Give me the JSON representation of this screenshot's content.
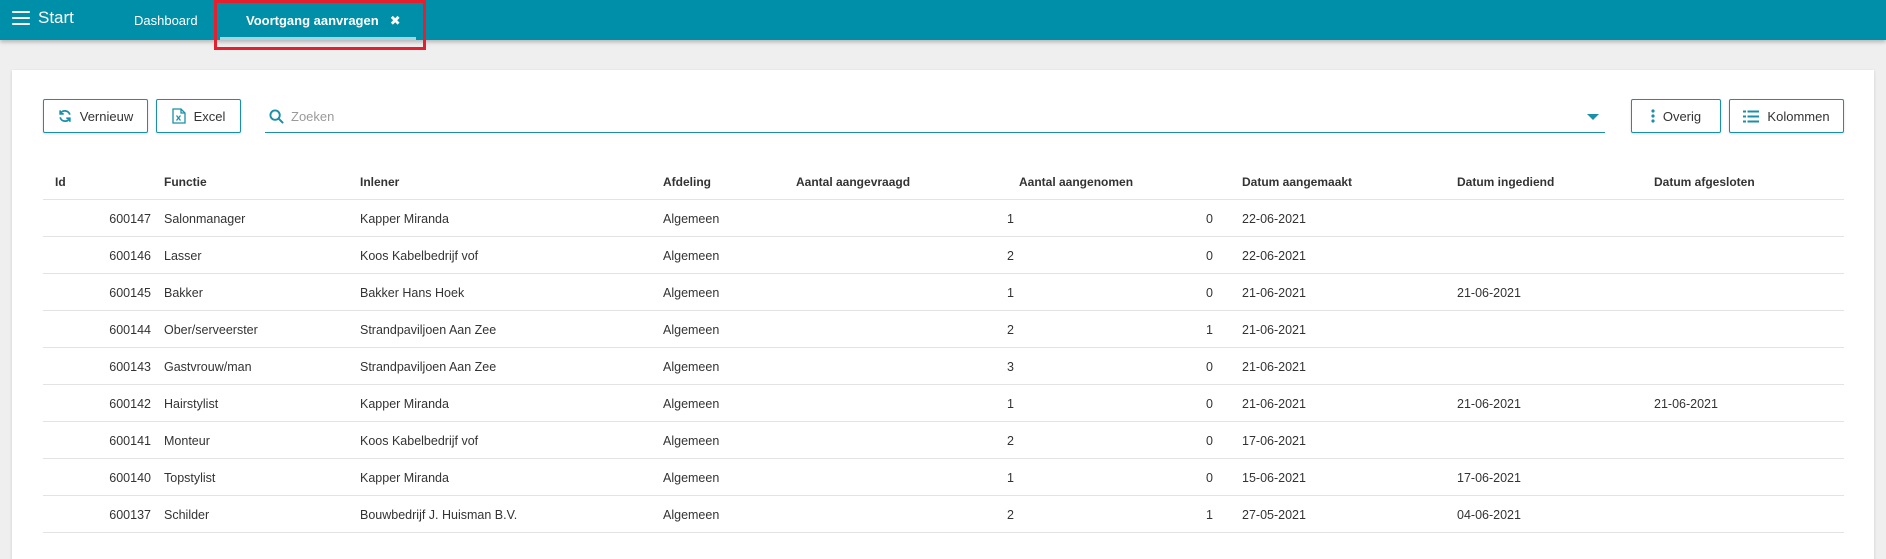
{
  "header": {
    "start_label": "Start",
    "tabs": [
      {
        "label": "Dashboard"
      },
      {
        "label": "Voortgang aanvragen"
      }
    ]
  },
  "toolbar": {
    "refresh_label": "Vernieuw",
    "excel_label": "Excel",
    "search_placeholder": "Zoeken",
    "overig_label": "Overig",
    "kolommen_label": "Kolommen"
  },
  "table": {
    "columns": [
      "Id",
      "Functie",
      "Inlener",
      "Afdeling",
      "Aantal aangevraagd",
      "Aantal aangenomen",
      "Datum aangemaakt",
      "Datum ingediend",
      "Datum afgesloten"
    ],
    "rows": [
      {
        "id": "600147",
        "functie": "Salonmanager",
        "inlener": "Kapper Miranda",
        "afdeling": "Algemeen",
        "aangevraagd": "1",
        "aangenomen": "0",
        "aangemaakt": "22-06-2021",
        "ingediend": "",
        "afgesloten": ""
      },
      {
        "id": "600146",
        "functie": "Lasser",
        "inlener": "Koos Kabelbedrijf vof",
        "afdeling": "Algemeen",
        "aangevraagd": "2",
        "aangenomen": "0",
        "aangemaakt": "22-06-2021",
        "ingediend": "",
        "afgesloten": ""
      },
      {
        "id": "600145",
        "functie": "Bakker",
        "inlener": "Bakker Hans Hoek",
        "afdeling": "Algemeen",
        "aangevraagd": "1",
        "aangenomen": "0",
        "aangemaakt": "21-06-2021",
        "ingediend": "21-06-2021",
        "afgesloten": ""
      },
      {
        "id": "600144",
        "functie": "Ober/serveerster",
        "inlener": "Strandpaviljoen Aan Zee",
        "afdeling": "Algemeen",
        "aangevraagd": "2",
        "aangenomen": "1",
        "aangemaakt": "21-06-2021",
        "ingediend": "",
        "afgesloten": ""
      },
      {
        "id": "600143",
        "functie": "Gastvrouw/man",
        "inlener": "Strandpaviljoen Aan Zee",
        "afdeling": "Algemeen",
        "aangevraagd": "3",
        "aangenomen": "0",
        "aangemaakt": "21-06-2021",
        "ingediend": "",
        "afgesloten": ""
      },
      {
        "id": "600142",
        "functie": "Hairstylist",
        "inlener": "Kapper Miranda",
        "afdeling": "Algemeen",
        "aangevraagd": "1",
        "aangenomen": "0",
        "aangemaakt": "21-06-2021",
        "ingediend": "21-06-2021",
        "afgesloten": "21-06-2021"
      },
      {
        "id": "600141",
        "functie": "Monteur",
        "inlener": "Koos Kabelbedrijf vof",
        "afdeling": "Algemeen",
        "aangevraagd": "2",
        "aangenomen": "0",
        "aangemaakt": "17-06-2021",
        "ingediend": "",
        "afgesloten": ""
      },
      {
        "id": "600140",
        "functie": "Topstylist",
        "inlener": "Kapper Miranda",
        "afdeling": "Algemeen",
        "aangevraagd": "1",
        "aangenomen": "0",
        "aangemaakt": "15-06-2021",
        "ingediend": "17-06-2021",
        "afgesloten": ""
      },
      {
        "id": "600137",
        "functie": "Schilder",
        "inlener": "Bouwbedrijf J. Huisman B.V.",
        "afdeling": "Algemeen",
        "aangevraagd": "2",
        "aangenomen": "1",
        "aangemaakt": "27-05-2021",
        "ingediend": "04-06-2021",
        "afgesloten": ""
      }
    ]
  },
  "colors": {
    "topbar": "#008fa8",
    "accent": "#1a8fa8",
    "highlight": "#e5202e"
  }
}
